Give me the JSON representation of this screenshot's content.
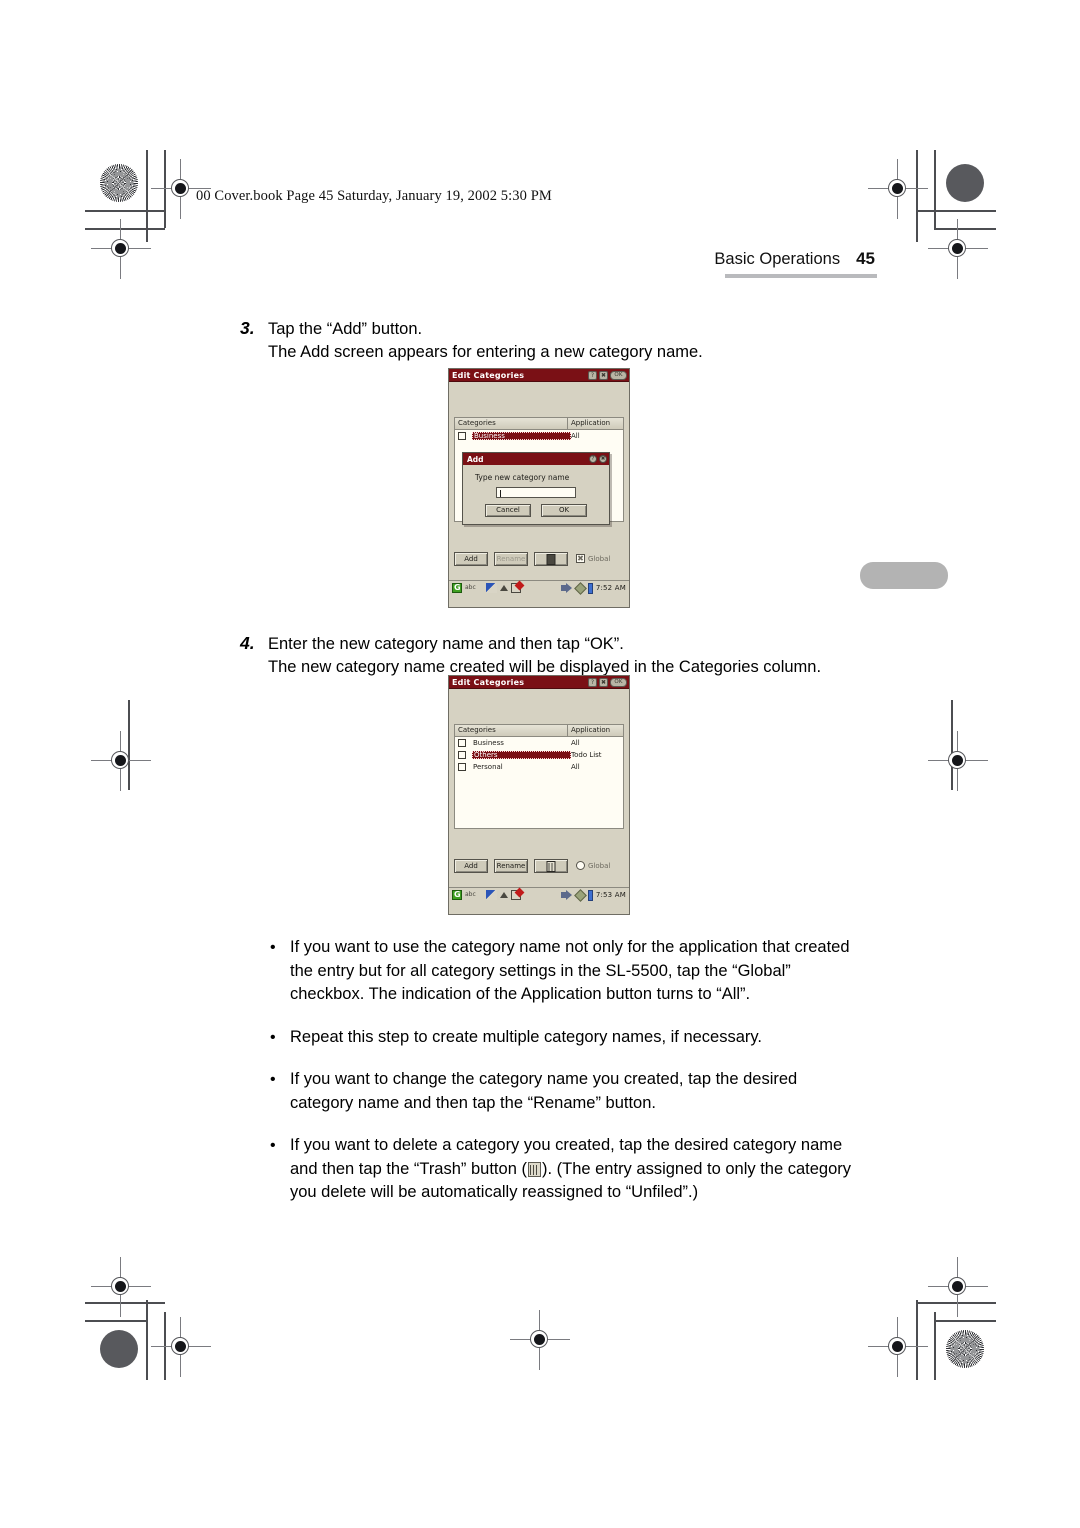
{
  "header": {
    "book_line": "00 Cover.book  Page 45  Saturday, January 19, 2002  5:30 PM",
    "running_head": "Basic Operations",
    "page_number": "45"
  },
  "steps": [
    {
      "num": "3.",
      "line1": "Tap the “Add” button.",
      "line2": "The Add screen appears for entering a new category name."
    },
    {
      "num": "4.",
      "line1": "Enter the new category name and then tap “OK”.",
      "line2": "The new category name created will be displayed in the Categories column."
    }
  ],
  "bullets": [
    {
      "marker": "•",
      "lines": [
        "If you want to use the category name not only for the application that created",
        "the entry but for all category settings in the SL-5500, tap the “Global”",
        "checkbox. The indication of the Application button turns to “All”."
      ]
    },
    {
      "marker": "•",
      "lines": [
        "Repeat this step to create multiple category names, if necessary."
      ]
    },
    {
      "marker": "•",
      "lines": [
        "If you want to change the category name you created, tap the desired",
        "category name and then tap the “Rename” button."
      ]
    },
    {
      "marker": "•",
      "trash_bullet": true,
      "lines_a": "If you want to delete a category you created, tap the desired category name",
      "lines_b_pre": "and then tap the “Trash” button  (",
      "lines_b_post": "). (The entry assigned to only the category",
      "lines_c": "you delete will be automatically reassigned to “Unfiled”.)"
    }
  ],
  "screenshot_add": {
    "title": "Edit Categories",
    "title_buttons": [
      "?",
      "✖",
      "OK"
    ],
    "columns": {
      "categories": "Categories",
      "application": "Application"
    },
    "rows": [
      {
        "name": "Business",
        "app": "All",
        "selected": true,
        "checked": false
      }
    ],
    "toolbar": {
      "add": "Add",
      "rename": "Rename",
      "rename_disabled": true,
      "trash_icon": "trash-icon",
      "global_label": "Global",
      "global_checked": true
    },
    "dialog": {
      "title": "Add",
      "buttons": [
        "?",
        "✖"
      ],
      "prompt": "Type new category name",
      "input_value": "",
      "cancel": "Cancel",
      "ok": "OK"
    },
    "status": {
      "home_icon": "home-icon",
      "abc_icon": "abc-input-icon",
      "pen_icon": "pen-icon",
      "up_icon": "up-arrow-icon",
      "note_icon": "note-icon",
      "speaker_icon": "speaker-icon",
      "diamond_icon": "diamond-icon",
      "battery_icon": "battery-icon",
      "time": "7:52 AM"
    }
  },
  "screenshot_result": {
    "title": "Edit Categories",
    "title_buttons": [
      "?",
      "✖",
      "OK"
    ],
    "columns": {
      "categories": "Categories",
      "application": "Application"
    },
    "rows": [
      {
        "name": "Business",
        "app": "All",
        "selected": false,
        "checked": false
      },
      {
        "name": "Others",
        "app": "Todo List",
        "selected": true,
        "checked": false
      },
      {
        "name": "Personal",
        "app": "All",
        "selected": false,
        "checked": false
      }
    ],
    "toolbar": {
      "add": "Add",
      "rename": "Rename",
      "rename_disabled": false,
      "trash_icon": "trash-icon",
      "global_label": "Global",
      "global_checked": false
    },
    "status": {
      "home_icon": "home-icon",
      "abc_icon": "abc-input-icon",
      "pen_icon": "pen-icon",
      "up_icon": "up-arrow-icon",
      "note_icon": "note-icon",
      "speaker_icon": "speaker-icon",
      "diamond_icon": "diamond-icon",
      "battery_icon": "battery-icon",
      "time": "7:53 AM"
    }
  },
  "colors": {
    "titlebar_maroon": "#7a1015",
    "pda_face": "#d6d2c2",
    "list_white": "#fffdf4",
    "side_tab_gray": "#b3b3b3"
  }
}
